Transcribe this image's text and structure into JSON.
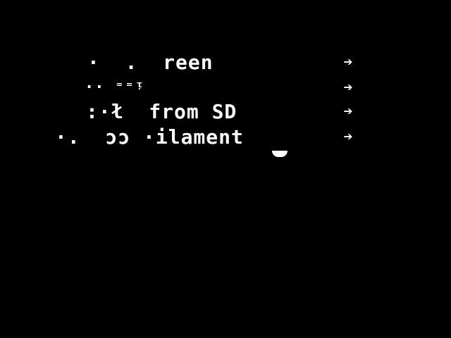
{
  "menu": {
    "items": [
      {
        "label": "·  .  reen",
        "arrow": "➔"
      },
      {
        "label": "·· ⁼⁼ᵎ",
        "arrow": "➔"
      },
      {
        "label": ":·ł  from SD",
        "arrow": "➔"
      },
      {
        "label": "·.  ɔɔ ·ilament",
        "arrow": "➔"
      }
    ]
  },
  "colors": {
    "background": "#000000",
    "foreground": "#ffffff"
  },
  "icons": {
    "arrow": "right-arrow-icon",
    "cursor": "cursor-indicator"
  }
}
